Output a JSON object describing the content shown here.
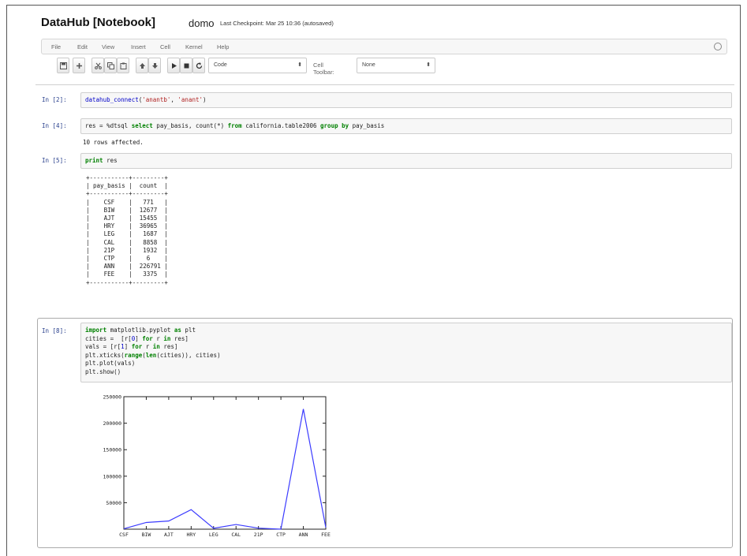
{
  "header": {
    "app_title": "DataHub [Notebook]",
    "notebook_name": "domo",
    "checkpoint": "Last Checkpoint: Mar 25 10:36 (autosaved)"
  },
  "menu": [
    "File",
    "Edit",
    "View",
    "Insert",
    "Cell",
    "Kernel",
    "Help"
  ],
  "toolbar": {
    "buttons": [
      "save-icon",
      "add-icon",
      "cut-icon",
      "copy-icon",
      "paste-icon",
      "move-up-icon",
      "move-down-icon",
      "run-icon",
      "stop-icon",
      "restart-icon"
    ],
    "cell_type": "Code",
    "cell_toolbar_label": "Cell Toolbar:",
    "cell_toolbar_value": "None"
  },
  "cells": [
    {
      "prompt": "In [2]:",
      "code": "datahub_connect('anantb', 'anant')"
    },
    {
      "prompt": "In [4]:",
      "code": "res = %dtsql select pay_basis, count(*) from california.table2006 group by pay_basis",
      "output": "10 rows affected."
    },
    {
      "prompt": "In [5]:",
      "code": "print res"
    },
    {
      "prompt": "In [8]:",
      "code_lines": [
        "import matplotlib.pyplot as plt",
        "cities =  [r[0] for r in res]",
        "vals = [r[1] for r in res]",
        "plt.xticks(range(len(cities)), cities)",
        "plt.plot(vals)",
        "plt.show()"
      ]
    }
  ],
  "result_table": {
    "border_top": "+-----------+---------+",
    "header": "| pay_basis |  count  |",
    "border_mid": "+-----------+---------+",
    "rows": [
      "|    CSF    |   771   |",
      "|    BIW    |  12677  |",
      "|    AJT    |  15455  |",
      "|    HRY    |  36965  |",
      "|    LEG    |   1687  |",
      "|    CAL    |   8858  |",
      "|    21P    |   1932  |",
      "|    CTP    |    6    |",
      "|    ANN    |  226791 |",
      "|    FEE    |   3375  |"
    ],
    "border_bottom": "+-----------+---------+"
  },
  "chart_data": {
    "type": "line",
    "categories": [
      "CSF",
      "BIW",
      "AJT",
      "HRY",
      "LEG",
      "CAL",
      "21P",
      "CTP",
      "ANN",
      "FEE"
    ],
    "values": [
      771,
      12677,
      15455,
      36965,
      1687,
      8858,
      1932,
      6,
      226791,
      3375
    ],
    "ylim": [
      0,
      250000
    ],
    "yticks": [
      "50000",
      "100000",
      "150000",
      "200000",
      "250000"
    ],
    "line_color": "#3b3bff"
  }
}
